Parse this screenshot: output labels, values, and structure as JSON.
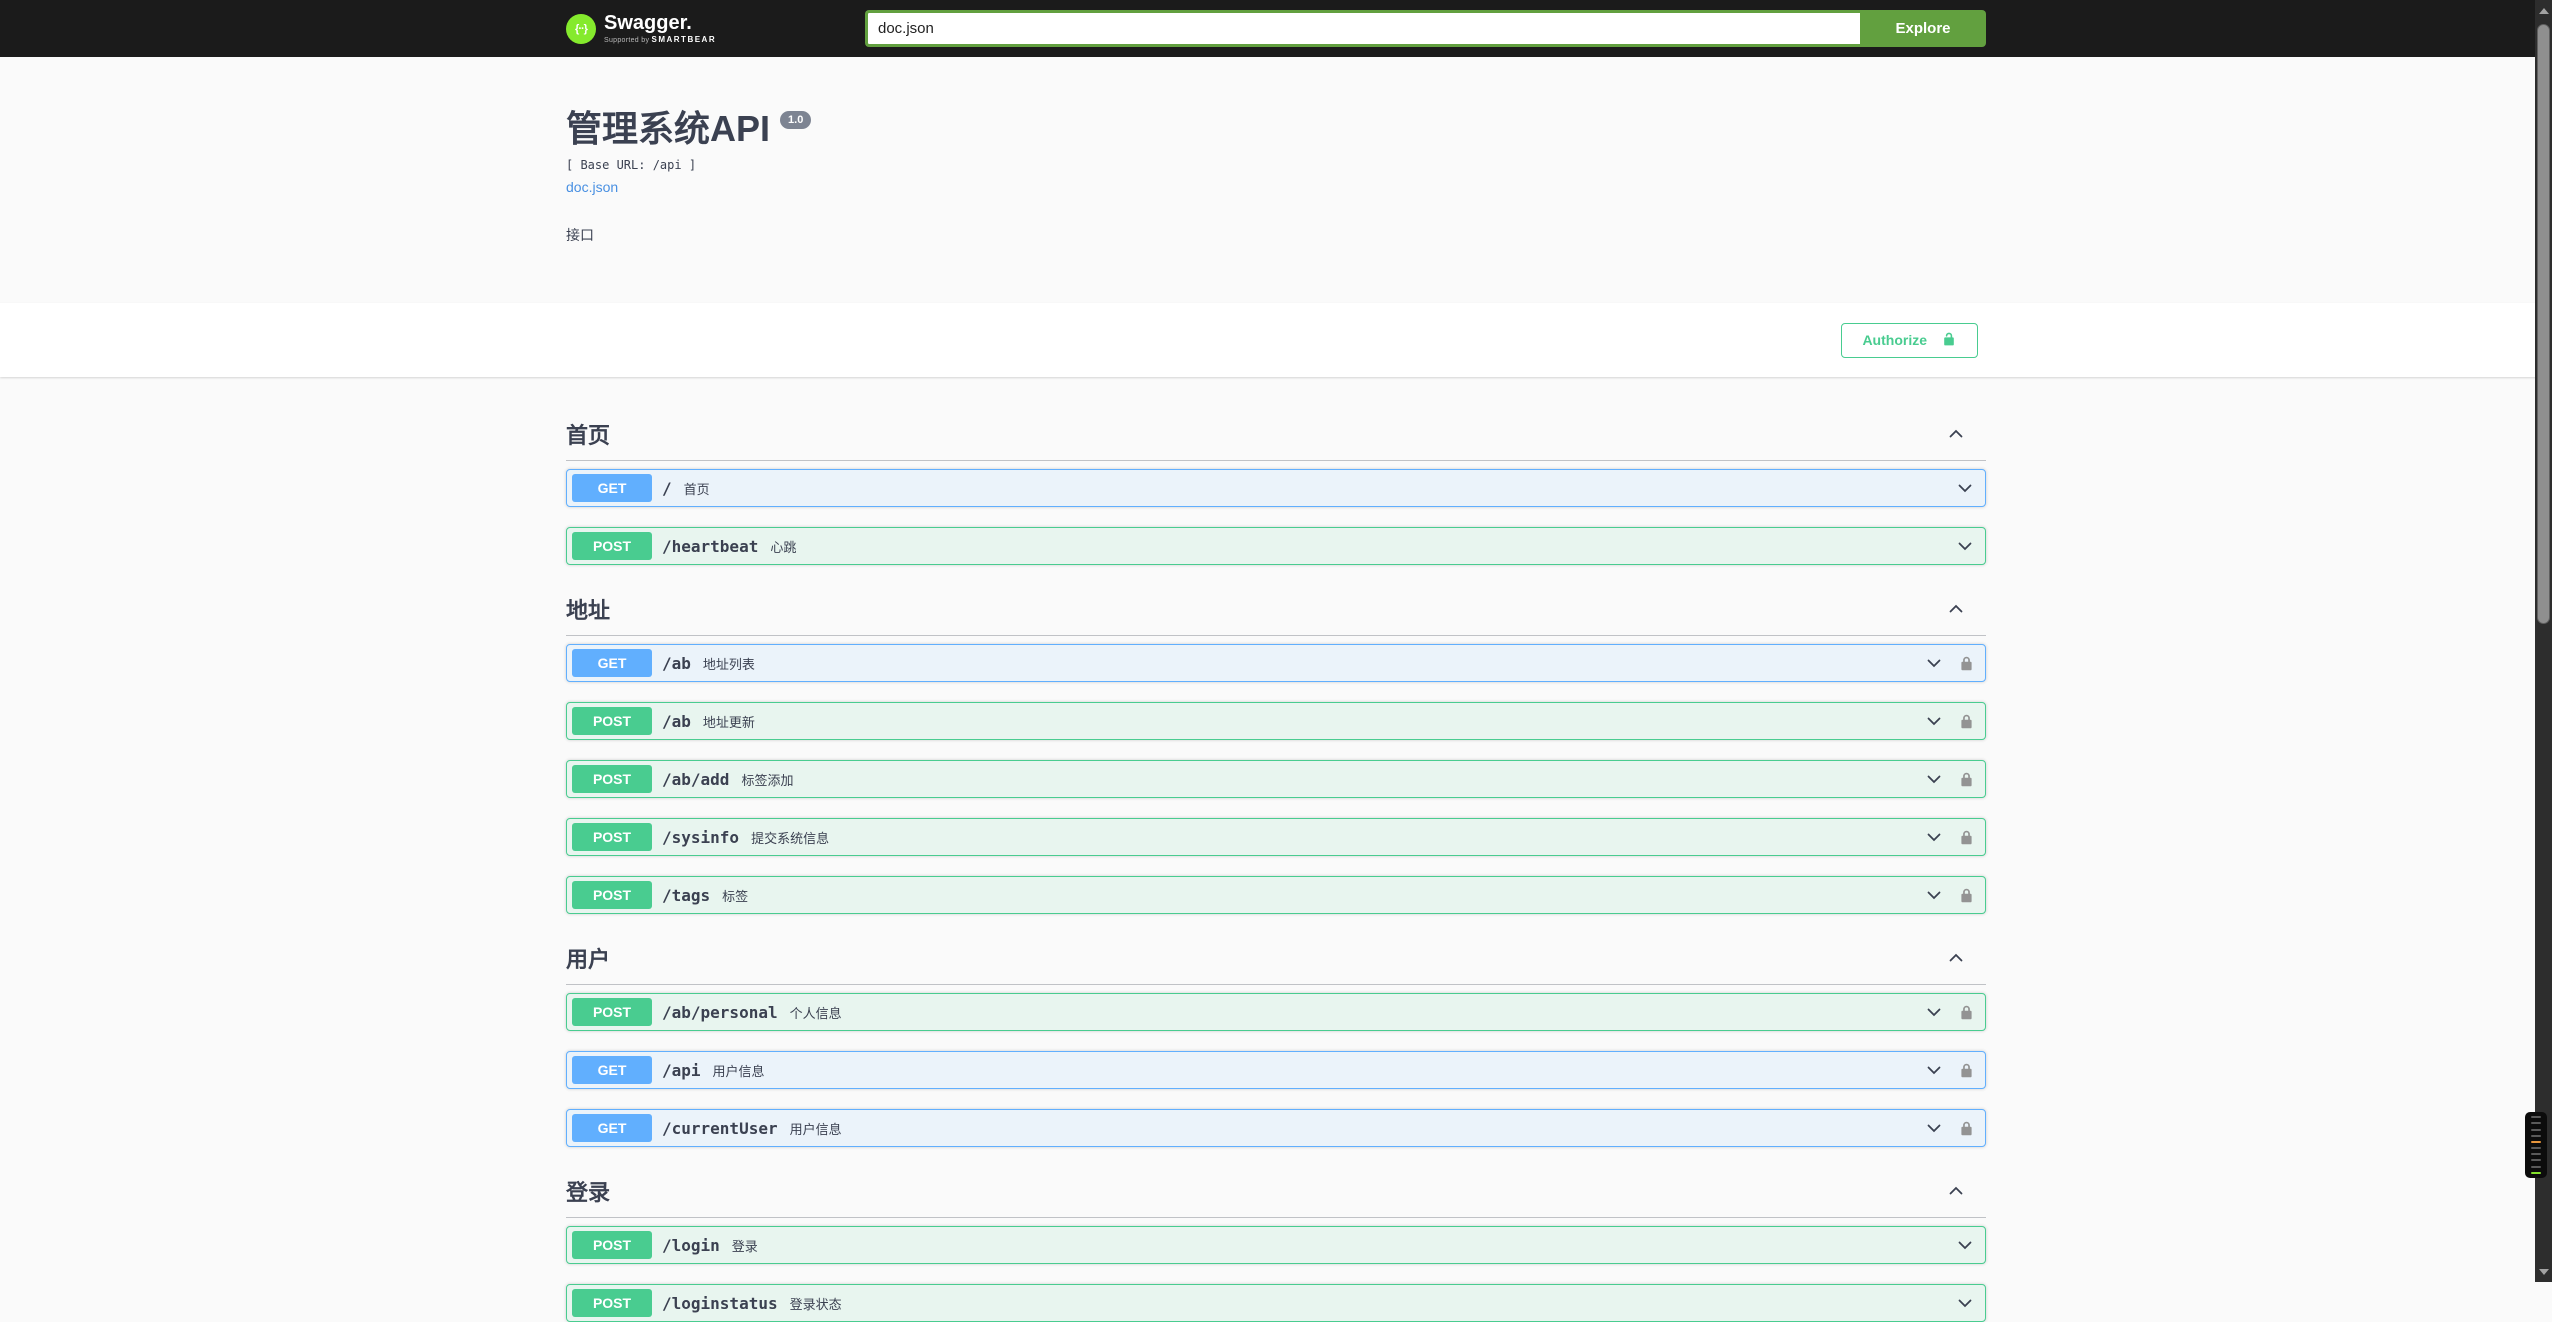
{
  "topbar": {
    "logo_text": "Swagger.",
    "logo_tagline_prefix": "Supported by ",
    "logo_tagline_brand": "SMARTBEAR",
    "search_value": "doc.json",
    "explore_label": "Explore"
  },
  "info": {
    "title": "管理系统API",
    "version": "1.0",
    "base_url_label": "[ Base URL: /api ]",
    "spec_link": "doc.json",
    "description": "接口"
  },
  "auth": {
    "authorize_label": "Authorize"
  },
  "colors": {
    "topbar_bg": "#1b1b1b",
    "brand_green": "#62a03f",
    "logo_green": "#85ea2d",
    "auth_green": "#49cc90",
    "link_blue": "#4990e2",
    "text": "#3b4151",
    "version_badge_bg": "#7d8492",
    "lock_gray": "#939393",
    "methods": {
      "GET": {
        "badge": "#61affe",
        "row_bg": "#ebf3fa",
        "row_border": "#61affe"
      },
      "POST": {
        "badge": "#49cc90",
        "row_bg": "#e8f5ef",
        "row_border": "#49cc90"
      }
    }
  },
  "sections": [
    {
      "name": "首页",
      "expanded": true,
      "operations": [
        {
          "method": "GET",
          "path": "/",
          "summary": "首页",
          "locked": false
        },
        {
          "method": "POST",
          "path": "/heartbeat",
          "summary": "心跳",
          "locked": false
        }
      ]
    },
    {
      "name": "地址",
      "expanded": true,
      "operations": [
        {
          "method": "GET",
          "path": "/ab",
          "summary": "地址列表",
          "locked": true
        },
        {
          "method": "POST",
          "path": "/ab",
          "summary": "地址更新",
          "locked": true
        },
        {
          "method": "POST",
          "path": "/ab/add",
          "summary": "标签添加",
          "locked": true
        },
        {
          "method": "POST",
          "path": "/sysinfo",
          "summary": "提交系统信息",
          "locked": true
        },
        {
          "method": "POST",
          "path": "/tags",
          "summary": "标签",
          "locked": true
        }
      ]
    },
    {
      "name": "用户",
      "expanded": true,
      "operations": [
        {
          "method": "POST",
          "path": "/ab/personal",
          "summary": "个人信息",
          "locked": true
        },
        {
          "method": "GET",
          "path": "/api",
          "summary": "用户信息",
          "locked": true
        },
        {
          "method": "GET",
          "path": "/currentUser",
          "summary": "用户信息",
          "locked": true
        }
      ]
    },
    {
      "name": "登录",
      "expanded": true,
      "operations": [
        {
          "method": "POST",
          "path": "/login",
          "summary": "登录",
          "locked": false
        },
        {
          "method": "POST",
          "path": "/loginstatus",
          "summary": "登录状态",
          "locked": false
        }
      ]
    }
  ],
  "minimap_lines": [
    "#5a5a5a",
    "#5a5a5a",
    "#5a5a5a",
    "#5a5a5a",
    "#e8963c",
    "#5a5a5a",
    "#5a5a5a",
    "#5a5a5a",
    "#5a5a5a",
    "#84e22b"
  ]
}
